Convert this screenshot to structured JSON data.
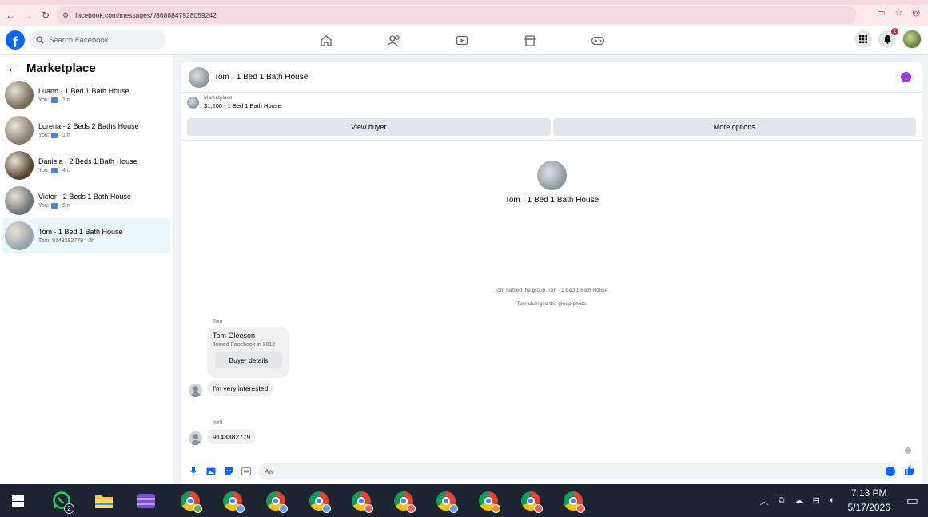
{
  "browser": {
    "url": "facebook.com/messages/t/8686847928059242"
  },
  "header": {
    "search_placeholder": "Search Facebook",
    "notification_count": "1"
  },
  "sidebar": {
    "title": "Marketplace",
    "conversations": [
      {
        "name": "Luann · 1 Bed 1 Bath House",
        "preview_prefix": "You:",
        "time": "· 1m",
        "avatar_color": "#7b6a5a",
        "active": false
      },
      {
        "name": "Lorena · 2 Beds 2 Baths House",
        "preview_prefix": "You:",
        "time": "· 1m",
        "avatar_color": "#8a7e70",
        "active": false
      },
      {
        "name": "Daniela · 2 Beds 1 Bath House",
        "preview_prefix": "You:",
        "time": "· 4m",
        "avatar_color": "#5a4332",
        "active": false
      },
      {
        "name": "Victor · 2 Beds 1 Bath House",
        "preview_prefix": "You:",
        "time": "· 5m",
        "avatar_color": "#6f7478",
        "active": false
      },
      {
        "name": "Tom · 1 Bed 1 Bath House",
        "preview_prefix": "Tom: 9143382779",
        "time": "· 3h",
        "avatar_color": "#9aa3ab",
        "active": true
      }
    ]
  },
  "chat": {
    "title": "Tom · 1 Bed 1 Bath House",
    "listing_source": "Marketplace",
    "listing_price": "$1,200 - 1 Bed 1 Bath House",
    "view_buyer": "View buyer",
    "more_options": "More options",
    "intro_title": "Tom · 1 Bed 1 Bath House",
    "system_messages": [
      "Tom named the group Tom · 1 Bed 1 Bath House.",
      "Tom changed the group photo."
    ],
    "sender_1": "Tom",
    "card_name": "Tom Gleeson",
    "card_sub": "Joined Facebook in 2012",
    "card_button": "Buyer details",
    "message_1": "I'm very interested",
    "sender_2": "Tom",
    "message_2": "9143382779",
    "composer_placeholder": "Aa"
  },
  "taskbar": {
    "whatsapp_badge": "2",
    "time": "7:13 PM",
    "date": "5/17/2026",
    "chrome_profile_colors": [
      "#6aa84f",
      "#6d9eeb",
      "#6d9eeb",
      "#6d9eeb",
      "#e06666",
      "#e06666",
      "#6d9eeb",
      "#e69138",
      "#e06666",
      "#e06666"
    ]
  },
  "colors": {
    "accent": "#0866ff",
    "info": "#a033e2",
    "active_row": "#ebf5ff"
  }
}
